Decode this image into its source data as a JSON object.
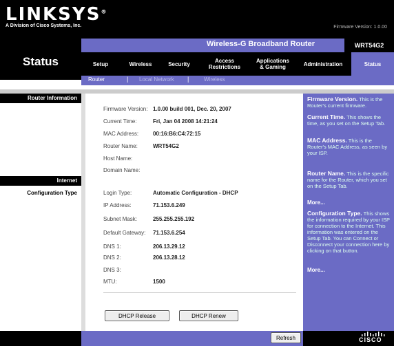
{
  "brand": {
    "logo": "LINKSYS",
    "logo_registered": "®",
    "subtitle": "A Division of Cisco Systems, Inc.",
    "firmware_top": "Firmware Version: 1.0.00"
  },
  "header": {
    "page_title": "Status",
    "product_name": "Wireless-G Broadband Router",
    "model": "WRT54G2"
  },
  "nav": {
    "items": [
      {
        "label": "Setup"
      },
      {
        "label": "Wireless"
      },
      {
        "label": "Security"
      },
      {
        "label": "Access\nRestrictions"
      },
      {
        "label": "Applications\n& Gaming"
      },
      {
        "label": "Administration"
      },
      {
        "label": "Status"
      }
    ],
    "subtabs": [
      {
        "label": "Router"
      },
      {
        "label": "Local Network"
      },
      {
        "label": "Wireless"
      }
    ],
    "separator": "|"
  },
  "sections": {
    "router_info": "Router Information",
    "internet": "Internet",
    "config_type": "Configuration Type"
  },
  "router": {
    "firmware_label": "Firmware Version:",
    "firmware_value": "1.0.00 build 001, Dec. 20, 2007",
    "time_label": "Current Time:",
    "time_value": "Fri, Jan 04 2008 14:21:24",
    "mac_label": "MAC Address:",
    "mac_value": "00:16:B6:C4:72:15",
    "name_label": "Router Name:",
    "name_value": "WRT54G2",
    "host_label": "Host Name:",
    "host_value": "",
    "domain_label": "Domain Name:",
    "domain_value": ""
  },
  "internet": {
    "login_label": "Login Type:",
    "login_value": "Automatic Configuration - DHCP",
    "ip_label": "IP Address:",
    "ip_value": "71.153.6.249",
    "mask_label": "Subnet Mask:",
    "mask_value": "255.255.255.192",
    "gw_label": "Default Gateway:",
    "gw_value": "71.153.6.254",
    "dns1_label": "DNS 1:",
    "dns1_value": "206.13.29.12",
    "dns2_label": "DNS 2:",
    "dns2_value": "206.13.28.12",
    "dns3_label": "DNS 3:",
    "dns3_value": "",
    "mtu_label": "MTU:",
    "mtu_value": "1500"
  },
  "buttons": {
    "release": "DHCP Release",
    "renew": "DHCP Renew",
    "refresh": "Refresh"
  },
  "help": {
    "fw_title": "Firmware Version.",
    "fw_text": "This is the Router's current firmware.",
    "time_title": "Current Time.",
    "time_text": "This shows the time, as you set on the Setup Tab.",
    "mac_title": "MAC Address.",
    "mac_text": "This is the Router's MAC Address, as seen by your ISP.",
    "name_title": "Router Name.",
    "name_text": "This is the specific name for the Router, which you set on the Setup Tab.",
    "more1": "More...",
    "cfg_title": "Configuration Type.",
    "cfg_text": "This shows the information required by your ISP for connection to the Internet. This information was entered on the Setup Tab. You can Connect or Disconnect your connection here by clicking on that button.",
    "more2": "More..."
  },
  "footer": {
    "cisco": "CISCO"
  },
  "colors": {
    "accent": "#6b6bc5",
    "black": "#000000"
  }
}
